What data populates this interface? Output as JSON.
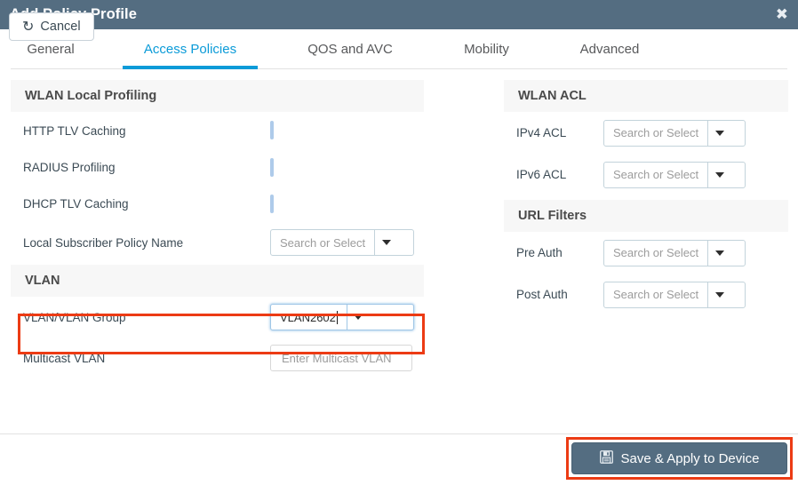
{
  "dialog": {
    "title": "Add Policy Profile",
    "close_icon": "close-icon"
  },
  "tabs": [
    {
      "label": "General",
      "active": false
    },
    {
      "label": "Access Policies",
      "active": true
    },
    {
      "label": "QOS and AVC",
      "active": false
    },
    {
      "label": "Mobility",
      "active": false
    },
    {
      "label": "Advanced",
      "active": false
    }
  ],
  "left": {
    "wlan_local_profiling": {
      "heading": "WLAN Local Profiling",
      "rows": [
        {
          "label": "HTTP TLV Caching",
          "type": "checkbox",
          "checked": false
        },
        {
          "label": "RADIUS Profiling",
          "type": "checkbox",
          "checked": false
        },
        {
          "label": "DHCP TLV Caching",
          "type": "checkbox",
          "checked": false
        },
        {
          "label": "Local Subscriber Policy Name",
          "type": "select",
          "value": "",
          "placeholder": "Search or Select"
        }
      ]
    },
    "vlan": {
      "heading": "VLAN",
      "rows": [
        {
          "label": "VLAN/VLAN Group",
          "type": "select",
          "value": "VLAN2602",
          "placeholder": "Search or Select",
          "focused": true,
          "highlighted": true
        },
        {
          "label": "Multicast VLAN",
          "type": "text",
          "value": "",
          "placeholder": "Enter Multicast VLAN"
        }
      ]
    }
  },
  "right": {
    "wlan_acl": {
      "heading": "WLAN ACL",
      "rows": [
        {
          "label": "IPv4 ACL",
          "type": "select",
          "value": "",
          "placeholder": "Search or Select"
        },
        {
          "label": "IPv6 ACL",
          "type": "select",
          "value": "",
          "placeholder": "Search or Select"
        }
      ]
    },
    "url_filters": {
      "heading": "URL Filters",
      "rows": [
        {
          "label": "Pre Auth",
          "type": "select",
          "value": "",
          "placeholder": "Search or Select"
        },
        {
          "label": "Post Auth",
          "type": "select",
          "value": "",
          "placeholder": "Search or Select"
        }
      ]
    }
  },
  "footer": {
    "cancel_label": "Cancel",
    "cancel_icon": "undo-icon",
    "save_label": "Save & Apply to Device",
    "save_icon": "floppy-disk-icon"
  },
  "colors": {
    "titlebar_bg": "#546d81",
    "accent_blue": "#0b9bd8",
    "section_bg": "#f7f7f7",
    "highlight_red": "#ec3b14",
    "save_button_bg": "#546d81"
  }
}
